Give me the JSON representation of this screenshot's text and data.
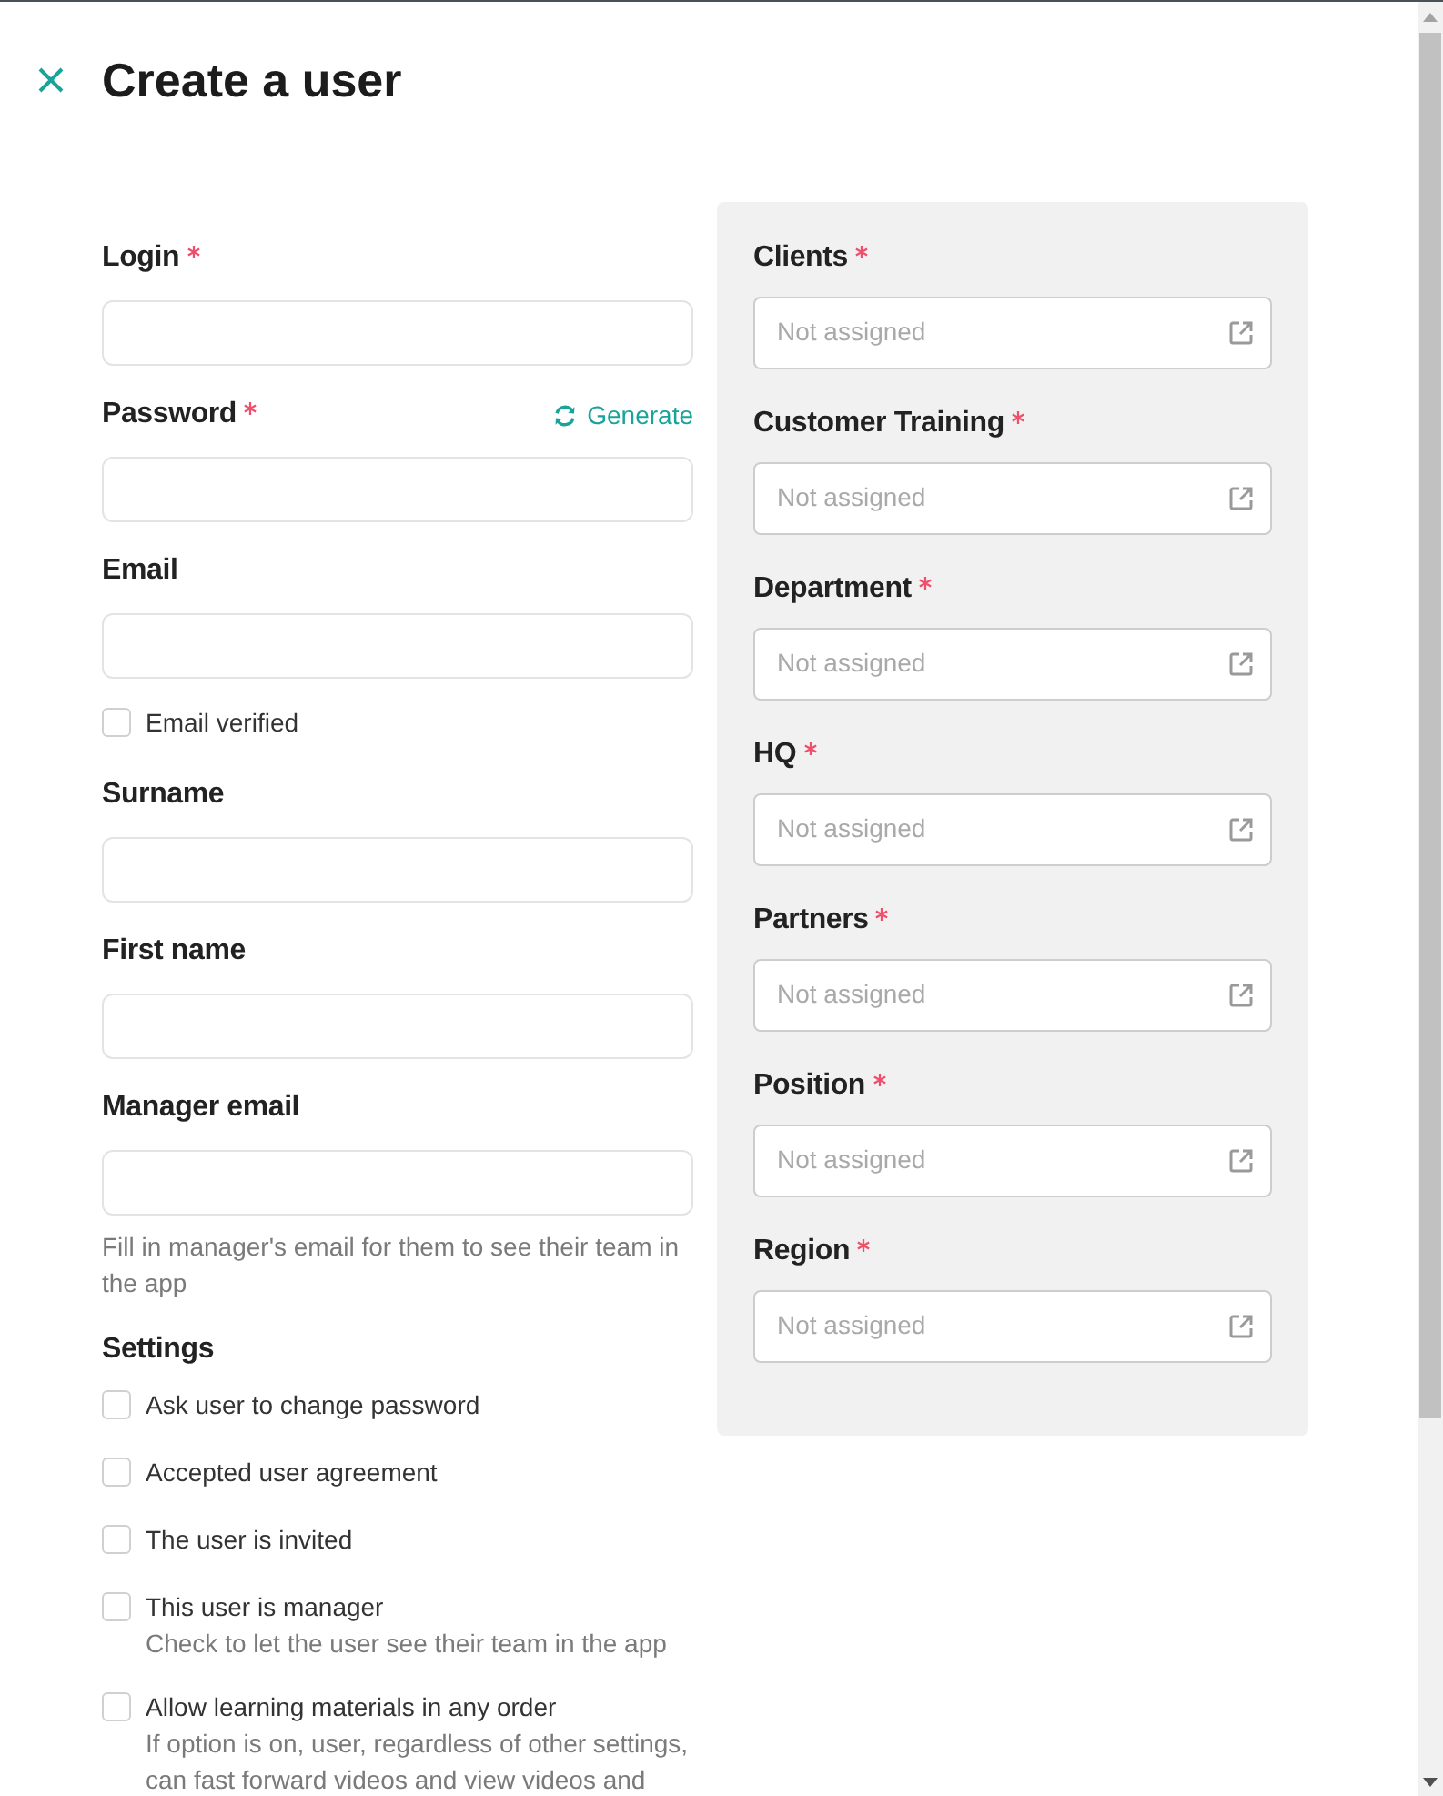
{
  "header": {
    "title": "Create a user"
  },
  "form": {
    "fields": [
      {
        "kind": "input",
        "label": "Login",
        "required": true
      },
      {
        "kind": "input",
        "label": "Password",
        "required": true,
        "action": "Generate"
      },
      {
        "kind": "input",
        "label": "Email",
        "required": false
      },
      {
        "kind": "checkbox",
        "label": "Email verified",
        "checked": false
      },
      {
        "kind": "input",
        "label": "Surname",
        "required": false
      },
      {
        "kind": "input",
        "label": "First name",
        "required": false
      },
      {
        "kind": "input",
        "label": "Manager email",
        "required": false,
        "hint": "Fill in manager's email for them to see their team in the app"
      }
    ]
  },
  "settings": {
    "title": "Settings",
    "options": [
      {
        "label": "Ask user to change password",
        "checked": false
      },
      {
        "label": "Accepted user agreement",
        "checked": false
      },
      {
        "label": "The user is invited",
        "checked": false
      },
      {
        "label": "This user is manager",
        "checked": false,
        "description": "Check to let the user see their team in the app"
      },
      {
        "label": "Allow learning materials in any order",
        "checked": false,
        "description": "If option is on, user, regardless of other settings, can fast forward videos and view videos and"
      }
    ]
  },
  "assignments": {
    "fields": [
      {
        "label": "Clients",
        "required": true,
        "placeholder": "Not assigned"
      },
      {
        "label": "Customer Training",
        "required": true,
        "placeholder": "Not assigned"
      },
      {
        "label": "Department",
        "required": true,
        "placeholder": "Not assigned"
      },
      {
        "label": "HQ",
        "required": true,
        "placeholder": "Not assigned"
      },
      {
        "label": "Partners",
        "required": true,
        "placeholder": "Not assigned"
      },
      {
        "label": "Position",
        "required": true,
        "placeholder": "Not assigned"
      },
      {
        "label": "Region",
        "required": true,
        "placeholder": "Not assigned"
      }
    ]
  }
}
